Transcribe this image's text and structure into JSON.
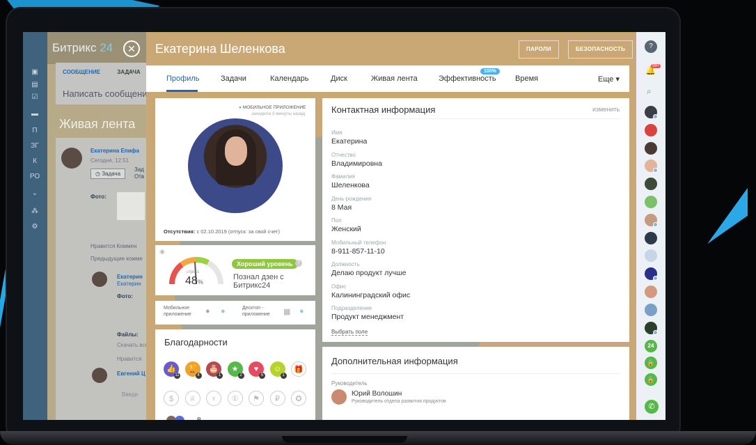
{
  "background_portal": {
    "logo_text": "Битрикс",
    "logo_num": "24",
    "tabs": [
      "СООБЩЕНИЕ",
      "ЗАДАЧА"
    ],
    "write_placeholder": "Написать сообщение",
    "feed_title": "Живая лента",
    "post_author": "Екатерина Епифа",
    "post_time": "Сегодня, 12:51",
    "task_button": "Задача",
    "task_text_a": "Зад",
    "task_text_b": "Отв",
    "photo_label": "Фото:",
    "likes_line": "Нравится  Коммен",
    "prev_comments": "Предыдущие комме",
    "comment_author_a": "Екатерин",
    "comment_author_b": "Екатерин",
    "comment_photo": "Фото:",
    "files_label": "Файлы:",
    "download": "Скачать все",
    "like2": "Нравится",
    "comment_author_c": "Евгений Ц",
    "input_hint": "Введи",
    "left_items": [
      "П",
      "ЗГ",
      "К",
      "РО"
    ]
  },
  "header": {
    "close_symbol": "✕",
    "person_name": "Екатерина Шеленкова",
    "btn_passwords": "ПАРОЛИ",
    "btn_security": "БЕЗОПАСНОСТЬ"
  },
  "tabs": {
    "items": [
      "Профиль",
      "Задачи",
      "Календарь",
      "Диск",
      "Живая лента",
      "Эффективность",
      "Время"
    ],
    "more": "Еще ▾",
    "efficiency_badge": "100%"
  },
  "profile_card": {
    "mobile_app_status": "МОБИЛЬНОЕ ПРИЛОЖЕНИЕ",
    "last_seen": "заходила 3 минуты назад",
    "absence_label": "Отсутствия:",
    "absence_text": "с 02.10.2019 (отпуск: за свой счет)"
  },
  "stress_card": {
    "stress_label": "стресс",
    "stress_value": "48",
    "percent": "%",
    "stress_level": 0.48,
    "level_badge": "Хороший уровень",
    "status_line1": "Познал дзен с",
    "status_line2": "Битрикс24",
    "help_icon": "?"
  },
  "apps_card": {
    "mobile_line1": "Мобильное",
    "mobile_line2": "приложение",
    "desktop_line1": "Десктоп -",
    "desktop_line2": "приложение"
  },
  "thanks_card": {
    "title": "Благодарности",
    "badges": [
      {
        "name": "like-badge-icon",
        "glyph": "👍",
        "color": "#6a5acd",
        "count": "11"
      },
      {
        "name": "cup-badge-icon",
        "glyph": "🏆",
        "color": "#f0a12b",
        "count": "4"
      },
      {
        "name": "cake-badge-icon",
        "glyph": "🎂",
        "color": "#b34c52",
        "count": "1"
      },
      {
        "name": "star-badge-icon",
        "glyph": "★",
        "color": "#55b848",
        "count": "2"
      },
      {
        "name": "heart-badge-icon",
        "glyph": "♥",
        "color": "#e84a5f",
        "count": "5"
      },
      {
        "name": "smile-badge-icon",
        "glyph": "☺",
        "color": "#b5d32a",
        "count": "1"
      },
      {
        "name": "gift-badge-icon",
        "glyph": "🎁",
        "color": "#ffffff",
        "count": ""
      }
    ],
    "badges_row2": [
      "money-badge-icon",
      "crown-badge-icon",
      "drink-badge-icon",
      "one-badge-icon",
      "flag-badge-icon",
      "ruble-badge-icon",
      "medal-badge-icon"
    ],
    "bottom_text": "В"
  },
  "contact_info": {
    "title": "Контактная информация",
    "edit_link": "изменить",
    "fields": [
      {
        "label": "Имя",
        "value": "Екатерина"
      },
      {
        "label": "Отчество",
        "value": "Владимировна"
      },
      {
        "label": "Фамилия",
        "value": "Шеленкова"
      },
      {
        "label": "День рождения",
        "value": "8 Мая"
      },
      {
        "label": "Пол",
        "value": "Женский"
      },
      {
        "label": "Мобильный телефон",
        "value": "8-911-857-11-10"
      },
      {
        "label": "Должность",
        "value": "Делаю продукт лучше"
      },
      {
        "label": "Офис",
        "value": "Калининградский офис"
      },
      {
        "label": "Подразделение",
        "value": "Продукт менеджмент"
      }
    ],
    "choose_field": "Выбрать поле"
  },
  "additional_info": {
    "title": "Дополнительная информация",
    "manager_label": "Руководитель",
    "manager_name": "Юрий Волошин",
    "manager_position": "Руководитель отдела развития продуктов"
  },
  "right_bar": {
    "notif_count": "99+",
    "counter_24": "24",
    "help": "?"
  },
  "colors": {
    "accent_blue": "#2067b0",
    "stress_good": "#8dc63f",
    "badge_blue": "#4bb0ec",
    "call_green": "#55b848"
  }
}
